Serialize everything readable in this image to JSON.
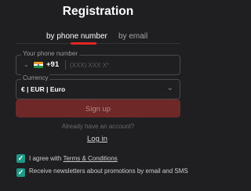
{
  "title": "Registration",
  "tabs": [
    {
      "label": "by phone number",
      "active": true
    },
    {
      "label": "by email",
      "active": false
    }
  ],
  "phone": {
    "label": "Your phone number",
    "country_code": "+91",
    "placeholder": "(XXX) XXX X*",
    "value": ""
  },
  "currency": {
    "label": "Currency",
    "value": "€ | EUR | Euro"
  },
  "signup_label": "Sign up",
  "already_text": "Already have an account?",
  "login_label": "Log in",
  "agree": {
    "prefix": "I agree with ",
    "link": "Terms & Conditions",
    "checked": true
  },
  "newsletter": {
    "text": "Receive newsletters about promotions by email and SMS",
    "checked": true
  },
  "colors": {
    "background": "#1f1f21",
    "accent": "#e32622",
    "signup_disabled": "#6e2828",
    "checkbox": "#1c9a86"
  },
  "icons": {
    "flag": "india-flag-icon",
    "chevron": "chevron-down-icon",
    "check": "checkmark-icon"
  }
}
